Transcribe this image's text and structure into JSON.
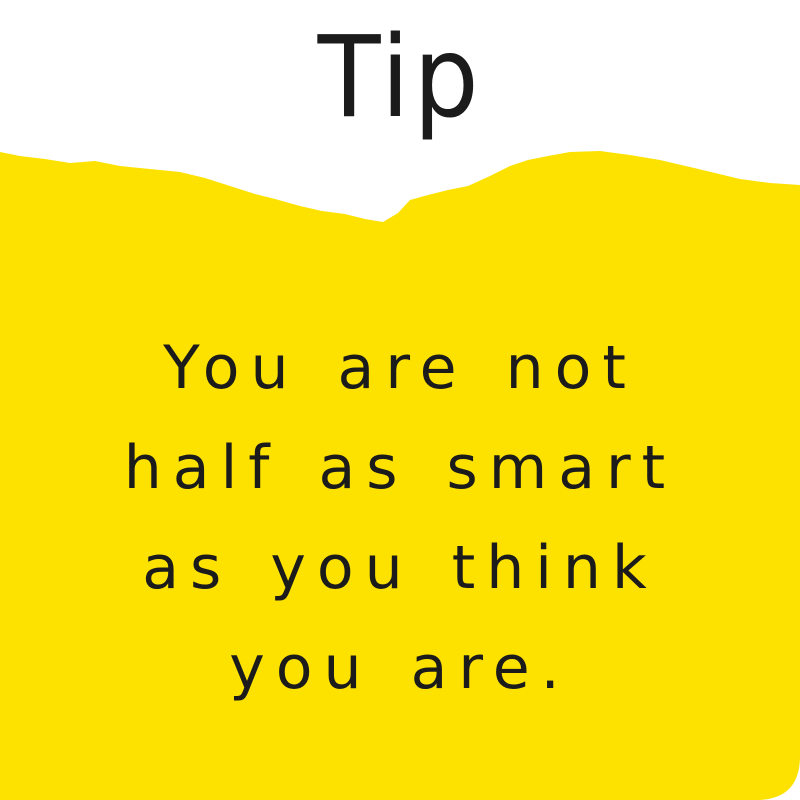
{
  "card": {
    "title": "Tip",
    "message_lines": [
      "You are not",
      "half as smart",
      "as you think",
      "you are."
    ]
  },
  "colors": {
    "background": "#ffffff",
    "panel": "#fde200",
    "text": "#1b1b1b"
  }
}
